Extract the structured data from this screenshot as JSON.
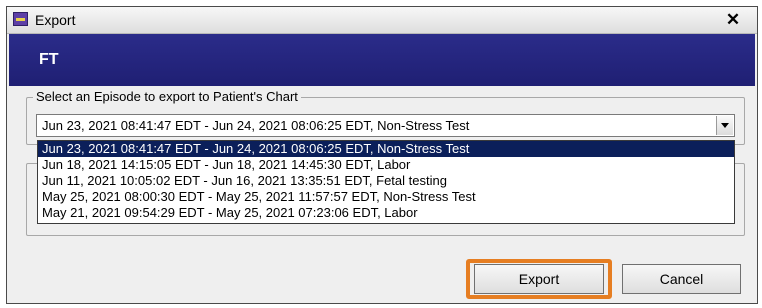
{
  "window": {
    "title": "Export",
    "close_glyph": "✕"
  },
  "header": {
    "title": "FT"
  },
  "episode_group": {
    "legend": "Select an Episode to export to Patient's Chart",
    "selected_value": "Jun 23, 2021 08:41:47 EDT - Jun 24, 2021 08:06:25 EDT, Non-Stress Test",
    "options": [
      "Jun 23, 2021 08:41:47 EDT - Jun 24, 2021 08:06:25 EDT, Non-Stress Test",
      "Jun 18, 2021 14:15:05 EDT - Jun 18, 2021 14:45:30 EDT, Labor",
      "Jun 11, 2021 10:05:02 EDT - Jun 16, 2021 13:35:51 EDT, Fetal testing",
      "May 25, 2021 08:00:30 EDT - May 25, 2021 11:57:57 EDT, Non-Stress Test",
      "May 21, 2021 09:54:29 EDT - May 25, 2021 07:23:06 EDT, Labor"
    ],
    "highlighted_index": 0
  },
  "buttons": {
    "export_label": "Export",
    "cancel_label": "Cancel"
  },
  "colors": {
    "header_band": "#23247f",
    "selection": "#0b1f5a",
    "highlight_outline": "#e67e22"
  }
}
